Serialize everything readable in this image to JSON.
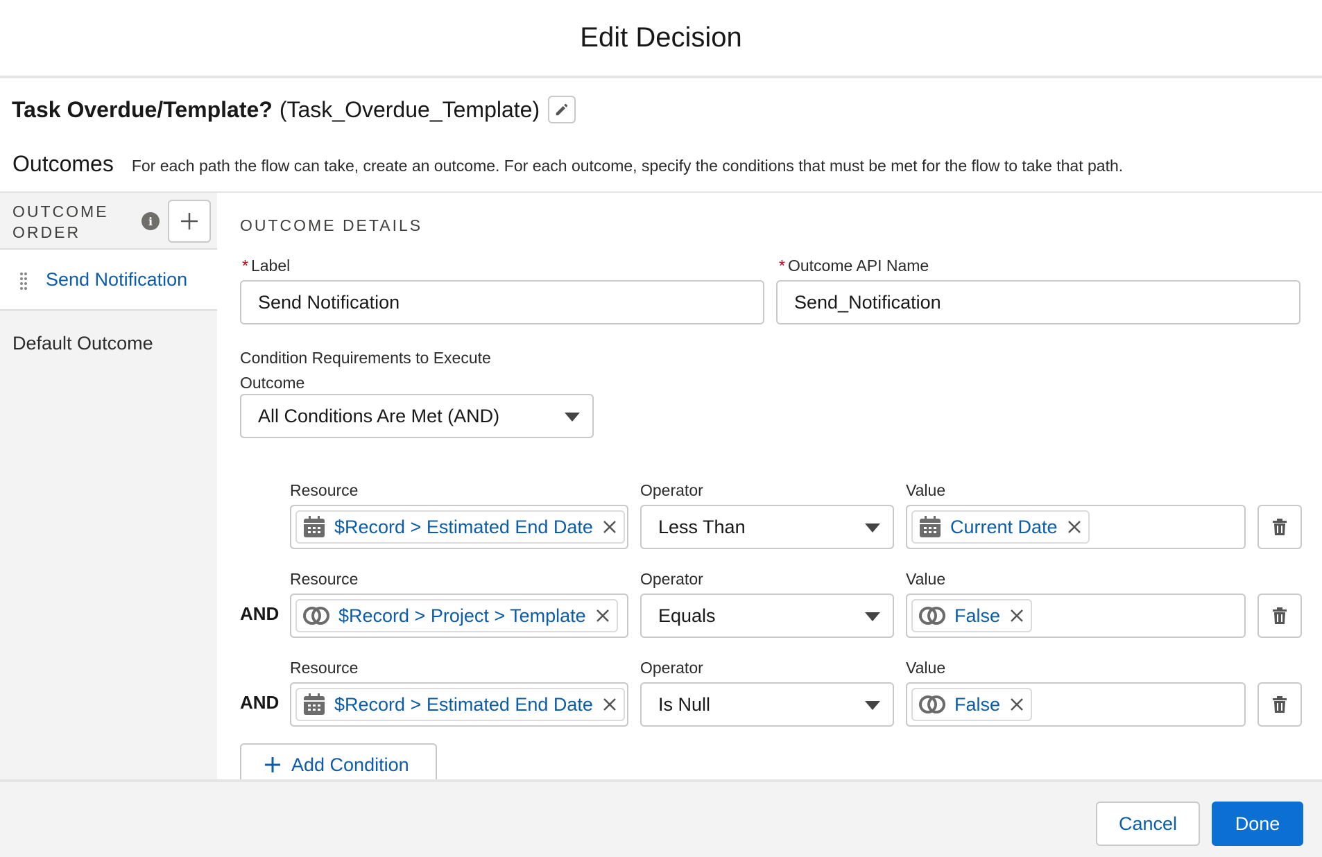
{
  "modal": {
    "title": "Edit Decision"
  },
  "element": {
    "label": "Task Overdue/Template?",
    "api_name": "(Task_Overdue_Template)",
    "edit_icon": "pencil-icon"
  },
  "outcomes": {
    "title": "Outcomes",
    "description": "For each path the flow can take, create an outcome. For each outcome, specify the conditions that must be met for the flow to take that path."
  },
  "sidebar": {
    "order_label_line1": "OUTCOME",
    "order_label_line2": "ORDER",
    "info_icon": "info-icon",
    "add_icon": "plus-icon",
    "items": [
      {
        "label": "Send Notification",
        "active": true
      },
      {
        "label": "Default Outcome",
        "active": false
      }
    ]
  },
  "details": {
    "section_title": "OUTCOME DETAILS",
    "label_field": {
      "label": "Label",
      "value": "Send Notification",
      "required": true
    },
    "api_field": {
      "label": "Outcome API Name",
      "value": "Send_Notification",
      "required": true
    },
    "requirements": {
      "label_line1": "Condition Requirements to Execute",
      "label_line2": "Outcome",
      "value": "All Conditions Are Met (AND)"
    },
    "column_labels": {
      "resource": "Resource",
      "operator": "Operator",
      "value": "Value"
    },
    "conditions": [
      {
        "prefix": "",
        "resource": "$Record > Estimated End Date",
        "resource_icon": "calendar-icon",
        "operator": "Less Than",
        "value": "Current Date",
        "value_icon": "calendar-icon"
      },
      {
        "prefix": "AND",
        "resource": "$Record > Project > Template",
        "resource_icon": "boolean-icon",
        "operator": "Equals",
        "value": "False",
        "value_icon": "boolean-icon"
      },
      {
        "prefix": "AND",
        "resource": "$Record > Estimated End Date",
        "resource_icon": "calendar-icon",
        "operator": "Is Null",
        "value": "False",
        "value_icon": "boolean-icon"
      }
    ],
    "add_condition": "Add Condition"
  },
  "footer": {
    "cancel": "Cancel",
    "done": "Done"
  },
  "colors": {
    "link": "#0b5cab",
    "brand": "#0b6fd4",
    "required": "#ba0517",
    "sidebar_bg": "#f3f3f3"
  }
}
